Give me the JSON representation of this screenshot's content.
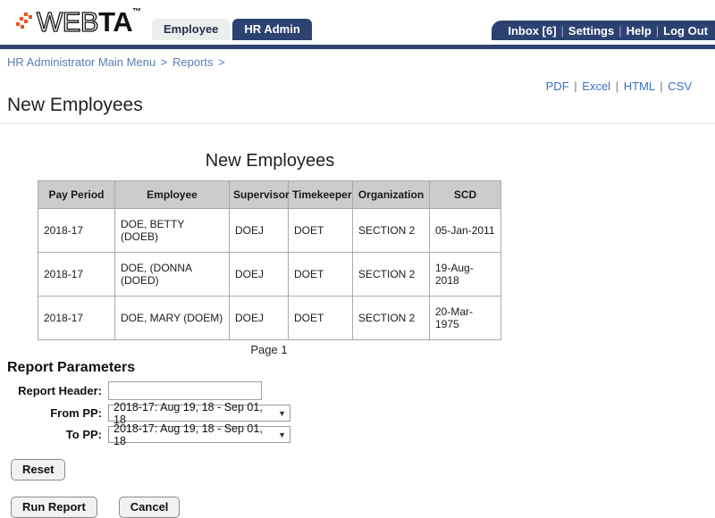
{
  "header": {
    "logo": {
      "text_light": "WEB",
      "text_bold": "TA",
      "trademark": "™",
      "dot_color": "#e8561f"
    },
    "tabs": [
      {
        "label": "Employee",
        "active": false
      },
      {
        "label": "HR Admin",
        "active": true
      }
    ],
    "topnav": [
      {
        "label": "Inbox [6]"
      },
      {
        "label": "Settings"
      },
      {
        "label": "Help"
      },
      {
        "label": "Log Out"
      }
    ],
    "separator": "|",
    "accent_navy": "#2c4271"
  },
  "breadcrumb": {
    "items": [
      "HR Administrator Main Menu",
      "Reports"
    ],
    "separator": ">",
    "trailing_separator": ">"
  },
  "exports": {
    "links": [
      "PDF",
      "Excel",
      "HTML",
      "CSV"
    ],
    "separator": "|"
  },
  "page": {
    "title": "New Employees"
  },
  "report": {
    "title": "New Employees",
    "columns": [
      "Pay Period",
      "Employee",
      "Supervisor",
      "Timekeeper",
      "Organization",
      "SCD"
    ],
    "rows": [
      [
        "2018-17",
        "DOE, BETTY (DOEB)",
        "DOEJ",
        "DOET",
        "SECTION 2",
        "05-Jan-2011"
      ],
      [
        "2018-17",
        "DOE, (DONNA (DOED)",
        "DOEJ",
        "DOET",
        "SECTION 2",
        "19-Aug-2018"
      ],
      [
        "2018-17",
        "DOE, MARY (DOEM)",
        "DOEJ",
        "DOET",
        "SECTION 2",
        "20-Mar-1975"
      ]
    ],
    "page_label": "Page 1"
  },
  "parameters": {
    "heading": "Report Parameters",
    "report_header": {
      "label": "Report Header:",
      "value": "",
      "placeholder": ""
    },
    "from_pp": {
      "label": "From PP:",
      "value": "2018-17: Aug 19, 18 - Sep 01, 18"
    },
    "to_pp": {
      "label": "To PP:",
      "value": "2018-17: Aug 19, 18 - Sep 01, 18"
    },
    "arrow": "▼"
  },
  "buttons": {
    "reset": "Reset",
    "run_report": "Run Report",
    "cancel": "Cancel"
  }
}
